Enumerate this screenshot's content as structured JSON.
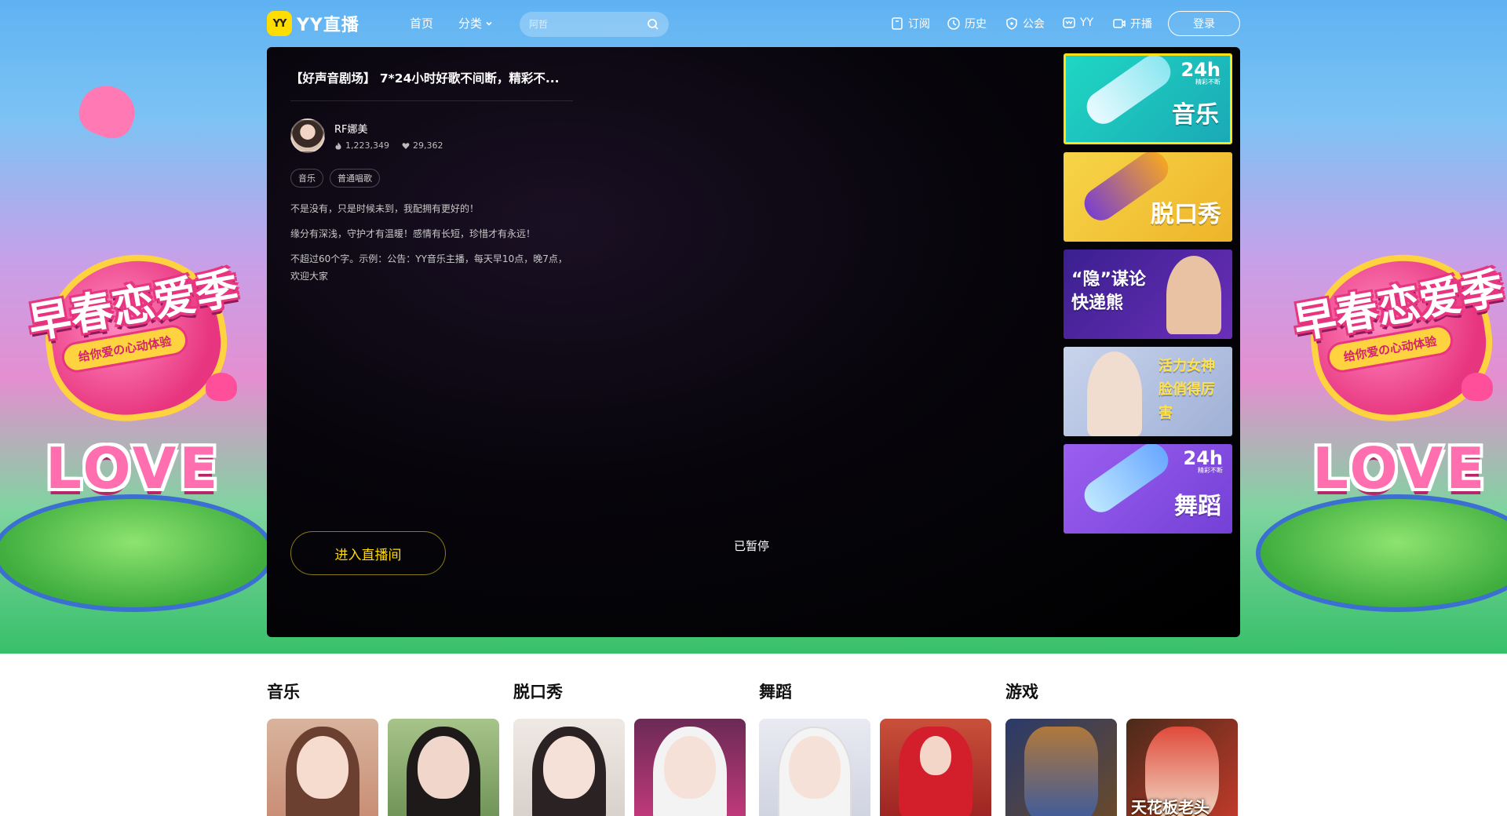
{
  "brand": {
    "badge": "YY",
    "name": "YY直播"
  },
  "nav": {
    "home": "首页",
    "category": "分类",
    "search_placeholder": "阿哲",
    "subscribe": "订阅",
    "history": "历史",
    "guild": "公会",
    "yy": "YY",
    "broadcast": "开播",
    "login": "登录"
  },
  "room": {
    "title": "【好声音剧场】 7*24小时好歌不间断，精彩不...",
    "anchor_name": "RF娜美",
    "heat": "1,223,349",
    "likes": "29,362",
    "tags": [
      "音乐",
      "普通唱歌"
    ],
    "desc": [
      "不是没有，只是时候未到，我配拥有更好的！",
      "缘分有深浅，守护才有温暖！感情有长短，珍惜才有永远！",
      "不超过60个字。示例：公告：YY音乐主播，每天早10点，晚7点，欢迎大家"
    ],
    "enter_label": "进入直播间",
    "status": "已暂停"
  },
  "side_banners": [
    {
      "label": "音乐",
      "badge": "24h",
      "badge_sub": "精彩不断",
      "active": true,
      "bg": "#26c9b7"
    },
    {
      "label": "脱口秀",
      "active": false,
      "bg": "#f2c338"
    },
    {
      "label": "“隐”谋论 快递熊",
      "active": false,
      "bg": "#4b2a9e"
    },
    {
      "label": "活力女神 脸俏得厉害",
      "active": false,
      "bg": "#b8c6e3"
    },
    {
      "label": "舞蹈",
      "badge": "24h",
      "badge_sub": "精彩不断",
      "active": false,
      "bg": "#8a52e3"
    }
  ],
  "hero": {
    "title": "早春恋爱季",
    "subtitle": "给你爱の心动体验",
    "love": "LOVE"
  },
  "categories": [
    {
      "title": "音乐",
      "thumbs": [
        {
          "text": ""
        },
        {
          "text": ""
        }
      ]
    },
    {
      "title": "脱口秀",
      "thumbs": [
        {
          "text": ""
        },
        {
          "text": ""
        }
      ]
    },
    {
      "title": "舞蹈",
      "thumbs": [
        {
          "text": ""
        },
        {
          "text": ""
        }
      ]
    },
    {
      "title": "游戏",
      "thumbs": [
        {
          "text": ""
        },
        {
          "text": "天花板老头"
        }
      ]
    }
  ],
  "colors": {
    "accent": "#ffd900",
    "nav_bg": "#5fb2f2",
    "player_bg": "#000000"
  }
}
